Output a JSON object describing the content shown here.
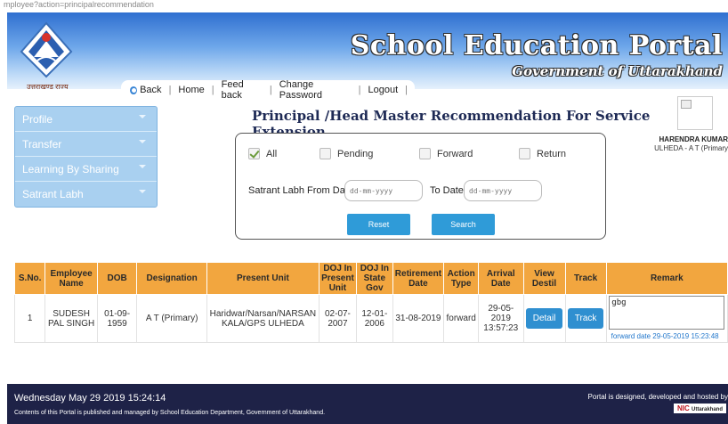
{
  "url": "mployee?action=principalrecommendation",
  "header": {
    "logo_caption": "उत्तराखण्ड राज्य",
    "title": "School Education Portal",
    "subtitle": "Government of Uttarakhand"
  },
  "nav": {
    "back": "Back",
    "home": "Home",
    "feedback": "Feed back",
    "change_password": "Change Password",
    "logout": "Logout"
  },
  "sidebar": {
    "items": [
      {
        "label": "Profile"
      },
      {
        "label": "Transfer"
      },
      {
        "label": "Learning By Sharing"
      },
      {
        "label": "Satrant Labh"
      }
    ]
  },
  "page_title": "Principal /Head Master Recommendation For Service Extension",
  "user": {
    "name": "HARENDRA KUMAR",
    "post": "ULHEDA - A T (Primary"
  },
  "filters": {
    "all": "All",
    "pending": "Pending",
    "forward": "Forward",
    "return": "Return",
    "from_label": "Satrant Labh From Date :",
    "to_label": "To Date :",
    "date_placeholder": "dd-mm-yyyy",
    "reset": "Reset",
    "search": "Search"
  },
  "table": {
    "headers": [
      "S.No.",
      "Employee Name",
      "DOB",
      "Designation",
      "Present Unit",
      "DOJ In Present Unit",
      "DOJ In State Gov",
      "Retirement Date",
      "Action Type",
      "Arrival Date",
      "View Destil",
      "Track",
      "Remark"
    ],
    "rows": [
      {
        "sno": "1",
        "name": "SUDESH PAL SINGH",
        "dob": "01-09-1959",
        "designation": "A T (Primary)",
        "unit": "Haridwar/Narsan/NARSAN KALA/GPS ULHEDA",
        "doj_unit": "02-07-2007",
        "doj_state": "12-01-2006",
        "retirement": "31-08-2019",
        "action": "forward",
        "arrival": "29-05-2019 13:57:23",
        "detail_btn": "Detail",
        "track_btn": "Track",
        "remark": "gbg",
        "remark_note": "forward date 29-05-2019 15:23:48"
      }
    ]
  },
  "footer": {
    "datetime": "Wednesday May 29 2019 15:24:14",
    "note": "Contents of this Portal is published and managed by School Education Department, Government of Uttarakhand.",
    "host": "Portal is designed, developed and hosted by",
    "nic": "NIC",
    "nic_sub": "Uttarakhand"
  }
}
